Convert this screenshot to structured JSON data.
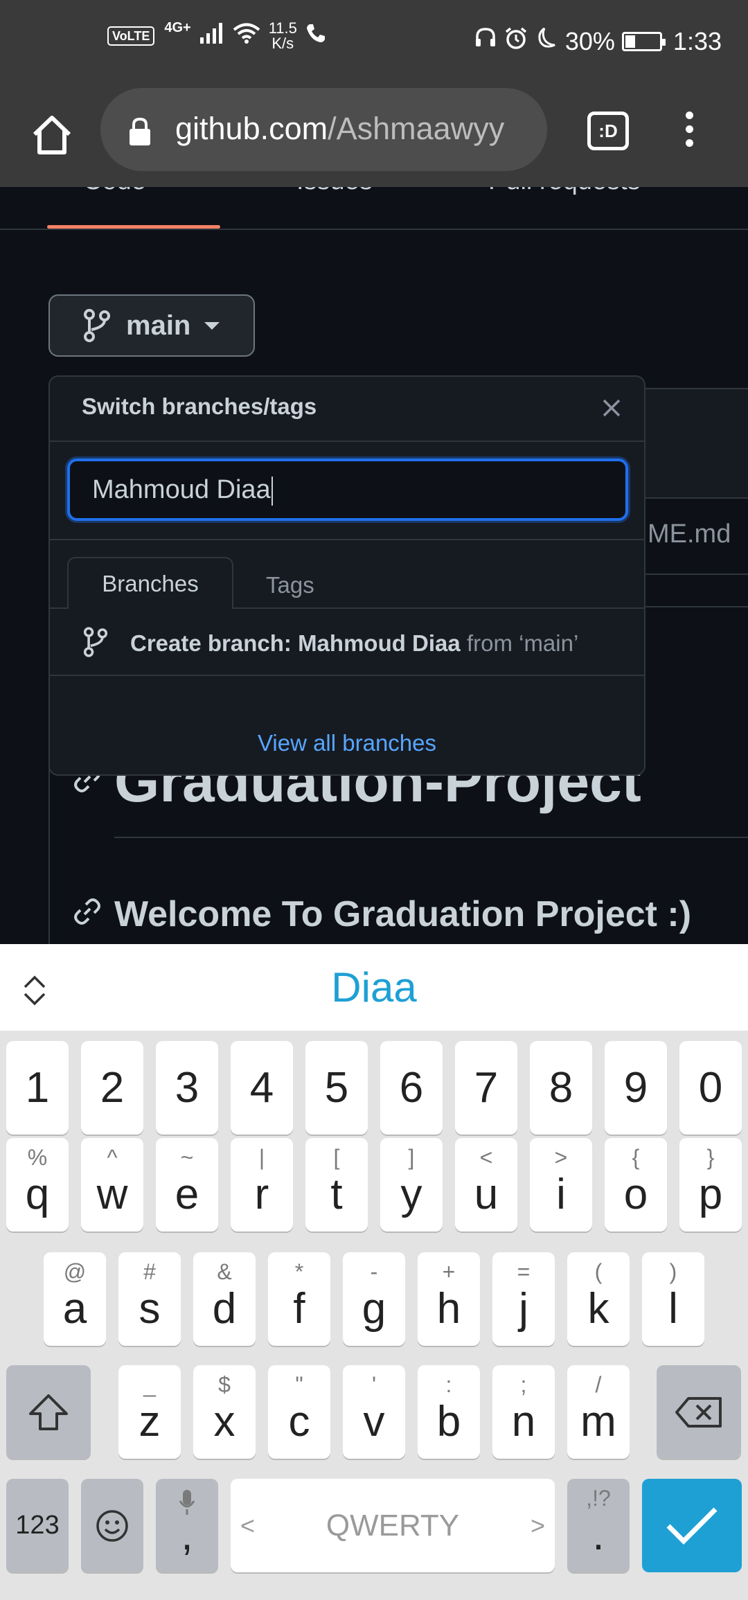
{
  "status_bar": {
    "volte": "VoLTE",
    "network": "4G+",
    "speed_value": "11.5",
    "speed_unit": "K/s",
    "battery_percent": "30%",
    "battery_level": 0.3,
    "time": "1:33"
  },
  "browser": {
    "url_domain": "github.com",
    "url_path": "/Ashmaawyy",
    "tab_switcher_label": ":D"
  },
  "repo_nav": {
    "tabs": [
      "Code",
      "Issues",
      "Pull requests"
    ]
  },
  "branch_button": {
    "label": "main"
  },
  "background": {
    "file_name": "ME.md",
    "heading1": "Graduation-Project",
    "heading2": "Welcome To Graduation Project :)"
  },
  "branch_dropdown": {
    "title": "Switch branches/tags",
    "filter_value": "Mahmoud Diaa",
    "tabs": [
      "Branches",
      "Tags"
    ],
    "create_prefix": "Create branch: Mahmoud Diaa",
    "create_suffix": "from ‘main’",
    "view_all": "View all branches"
  },
  "keyboard": {
    "suggestion": "Diaa",
    "number_row": [
      "1",
      "2",
      "3",
      "4",
      "5",
      "6",
      "7",
      "8",
      "9",
      "0"
    ],
    "row1": [
      {
        "main": "q",
        "sub": "%"
      },
      {
        "main": "w",
        "sub": "^"
      },
      {
        "main": "e",
        "sub": "~"
      },
      {
        "main": "r",
        "sub": "|"
      },
      {
        "main": "t",
        "sub": "["
      },
      {
        "main": "y",
        "sub": "]"
      },
      {
        "main": "u",
        "sub": "<"
      },
      {
        "main": "i",
        "sub": ">"
      },
      {
        "main": "o",
        "sub": "{"
      },
      {
        "main": "p",
        "sub": "}"
      }
    ],
    "row2": [
      {
        "main": "a",
        "sub": "@"
      },
      {
        "main": "s",
        "sub": "#"
      },
      {
        "main": "d",
        "sub": "&"
      },
      {
        "main": "f",
        "sub": "*"
      },
      {
        "main": "g",
        "sub": "-"
      },
      {
        "main": "h",
        "sub": "+"
      },
      {
        "main": "j",
        "sub": "="
      },
      {
        "main": "k",
        "sub": "("
      },
      {
        "main": "l",
        "sub": ")"
      }
    ],
    "row3": [
      {
        "main": "z",
        "sub": "_"
      },
      {
        "main": "x",
        "sub": "$"
      },
      {
        "main": "c",
        "sub": "\""
      },
      {
        "main": "v",
        "sub": "'"
      },
      {
        "main": "b",
        "sub": ":"
      },
      {
        "main": "n",
        "sub": ";"
      },
      {
        "main": "m",
        "sub": "/"
      }
    ],
    "symbols_label": "123",
    "comma_label": ",",
    "space_label": "QWERTY",
    "space_left": "<",
    "space_right": ">",
    "period_label": ".",
    "period_sub": ",!?"
  }
}
